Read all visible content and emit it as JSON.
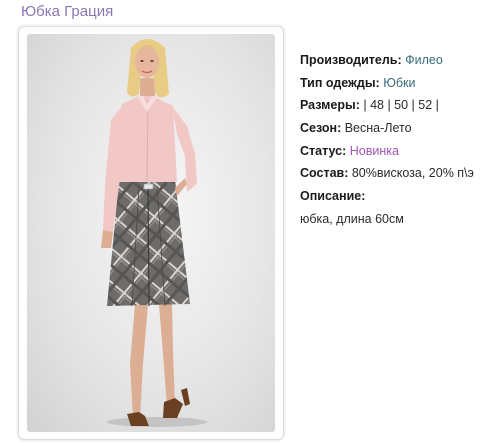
{
  "product": {
    "title": "Юбка Грация",
    "image_subject": "model wearing pink blouse and grey plaid skirt",
    "specs": {
      "manufacturer": {
        "label": "Производитель:",
        "value": "Филео"
      },
      "clothing_type": {
        "label": "Тип одежды:",
        "value": "Юбки"
      },
      "sizes": {
        "label": "Размеры:",
        "value": "| 48 | 50 | 52 |"
      },
      "season": {
        "label": "Сезон:",
        "value": "Весна-Лето"
      },
      "status": {
        "label": "Статус:",
        "value": "Новинка"
      },
      "composition": {
        "label": "Состав:",
        "value": "80%вискоза, 20% п\\э"
      },
      "description": {
        "label": "Описание:",
        "value": "юбка, длина 60см"
      }
    }
  },
  "colors": {
    "title": "#8c76b4",
    "link_teal": "#3a6d7d",
    "link_purple": "#a155b8"
  }
}
